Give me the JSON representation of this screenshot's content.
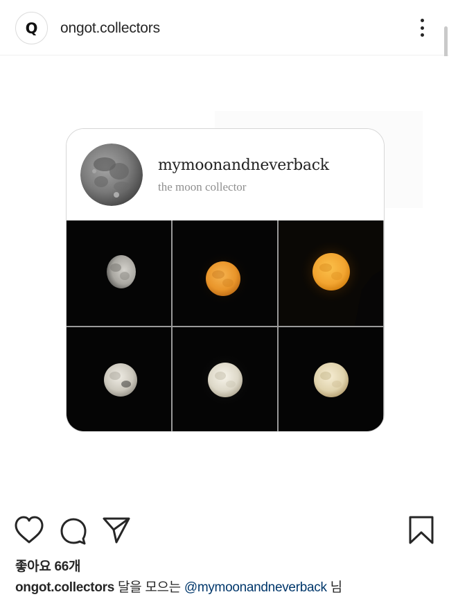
{
  "header": {
    "avatar_letter": "Q",
    "username": "ongot.collectors",
    "menu_icon": "more-vertical-icon"
  },
  "embedded_card": {
    "title": "mymoonandneverback",
    "subtitle": "the moon collector",
    "avatar_icon": "full-moon-photo",
    "photos": [
      {
        "name": "gibbous-moon-grey"
      },
      {
        "name": "full-moon-orange"
      },
      {
        "name": "full-moon-amber-glow"
      },
      {
        "name": "full-moon-white"
      },
      {
        "name": "full-moon-white-glow"
      },
      {
        "name": "full-moon-cream"
      }
    ]
  },
  "actions": {
    "like_icon": "heart-icon",
    "comment_icon": "comment-icon",
    "share_icon": "send-icon",
    "save_icon": "bookmark-icon"
  },
  "likes_text": "좋아요 66개",
  "caption": {
    "author": "ongot.collectors",
    "text_before": " 달을 모으는 ",
    "mention": "@mymoonandneverback",
    "text_after": " 님"
  },
  "colors": {
    "mention": "#00376b",
    "photo_background": "#050505",
    "moon_orange": "#e9952a",
    "moon_amber": "#f2a531"
  }
}
